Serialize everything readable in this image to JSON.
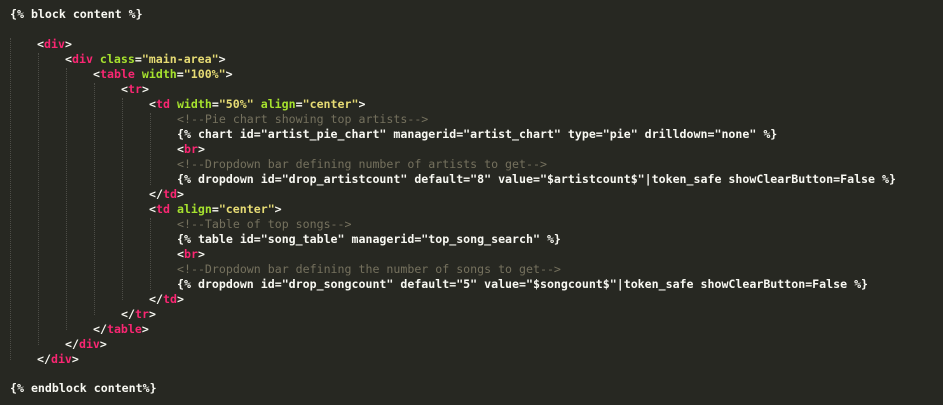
{
  "editor": {
    "theme_colors": {
      "background": "#272822",
      "tag": "#f92672",
      "attribute": "#a6e22e",
      "string": "#e6db74",
      "comment": "#75715e",
      "text": "#f8f8f2"
    },
    "lines": {
      "l1": "{% block content %}",
      "l3": {
        "tag": "div"
      },
      "l4": {
        "tag": "div",
        "attr": "class",
        "value": "\"main-area\""
      },
      "l5": {
        "tag": "table",
        "attr": "width",
        "value": "\"100%\""
      },
      "l6": {
        "tag": "tr"
      },
      "l7": {
        "tag": "td",
        "attr1": "width",
        "value1": "\"50%\"",
        "attr2": "align",
        "value2": "\"center\""
      },
      "l8": "<!--Pie chart showing top artists-->",
      "l9": "{% chart id=\"artist_pie_chart\" managerid=\"artist_chart\" type=\"pie\" drilldown=\"none\" %}",
      "l10": {
        "tag": "br"
      },
      "l11": "<!--Dropdown bar defining number of artists to get-->",
      "l12": "{% dropdown id=\"drop_artistcount\" default=\"8\" value=\"$artistcount$\"|token_safe showClearButton=False %}",
      "l13": {
        "tag": "td"
      },
      "l14": {
        "tag": "td",
        "attr": "align",
        "value": "\"center\""
      },
      "l15": "<!--Table of top songs-->",
      "l16": "{% table id=\"song_table\" managerid=\"top_song_search\" %}",
      "l17": {
        "tag": "br"
      },
      "l18": "<!--Dropdown bar defining the number of songs to get-->",
      "l19": "{% dropdown id=\"drop_songcount\" default=\"5\" value=\"$songcount$\"|token_safe showClearButton=False %}",
      "l20": {
        "tag": "td"
      },
      "l21": {
        "tag": "tr"
      },
      "l22": {
        "tag": "table"
      },
      "l23": {
        "tag": "div"
      },
      "l24": {
        "tag": "div"
      },
      "l26": "{% endblock content%}"
    }
  }
}
